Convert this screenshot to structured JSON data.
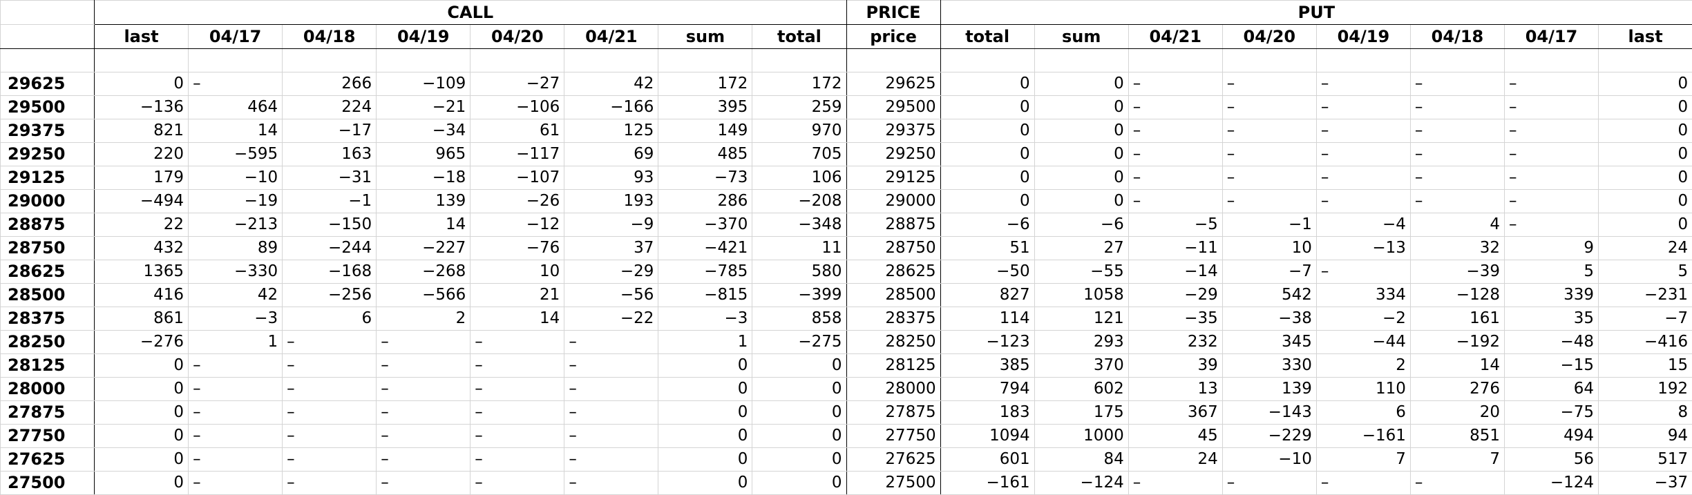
{
  "groups": {
    "call": "CALL",
    "price": "PRICE",
    "put": "PUT"
  },
  "headers": [
    "",
    "last",
    "04/17",
    "04/18",
    "04/19",
    "04/20",
    "04/21",
    "sum",
    "total",
    "price",
    "total",
    "sum",
    "04/21",
    "04/20",
    "04/19",
    "04/18",
    "04/17",
    "last"
  ],
  "rows": [
    [
      "29625",
      "0",
      "–",
      "266",
      "−109",
      "−27",
      "42",
      "172",
      "172",
      "29625",
      "0",
      "0",
      "–",
      "–",
      "–",
      "–",
      "–",
      "0"
    ],
    [
      "29500",
      "−136",
      "464",
      "224",
      "−21",
      "−106",
      "−166",
      "395",
      "259",
      "29500",
      "0",
      "0",
      "–",
      "–",
      "–",
      "–",
      "–",
      "0"
    ],
    [
      "29375",
      "821",
      "14",
      "−17",
      "−34",
      "61",
      "125",
      "149",
      "970",
      "29375",
      "0",
      "0",
      "–",
      "–",
      "–",
      "–",
      "–",
      "0"
    ],
    [
      "29250",
      "220",
      "−595",
      "163",
      "965",
      "−117",
      "69",
      "485",
      "705",
      "29250",
      "0",
      "0",
      "–",
      "–",
      "–",
      "–",
      "–",
      "0"
    ],
    [
      "29125",
      "179",
      "−10",
      "−31",
      "−18",
      "−107",
      "93",
      "−73",
      "106",
      "29125",
      "0",
      "0",
      "–",
      "–",
      "–",
      "–",
      "–",
      "0"
    ],
    [
      "29000",
      "−494",
      "−19",
      "−1",
      "139",
      "−26",
      "193",
      "286",
      "−208",
      "29000",
      "0",
      "0",
      "–",
      "–",
      "–",
      "–",
      "–",
      "0"
    ],
    [
      "28875",
      "22",
      "−213",
      "−150",
      "14",
      "−12",
      "−9",
      "−370",
      "−348",
      "28875",
      "−6",
      "−6",
      "−5",
      "−1",
      "−4",
      "4",
      "–",
      "0"
    ],
    [
      "28750",
      "432",
      "89",
      "−244",
      "−227",
      "−76",
      "37",
      "−421",
      "11",
      "28750",
      "51",
      "27",
      "−11",
      "10",
      "−13",
      "32",
      "9",
      "24"
    ],
    [
      "28625",
      "1365",
      "−330",
      "−168",
      "−268",
      "10",
      "−29",
      "−785",
      "580",
      "28625",
      "−50",
      "−55",
      "−14",
      "−7",
      "–",
      "−39",
      "5",
      "5"
    ],
    [
      "28500",
      "416",
      "42",
      "−256",
      "−566",
      "21",
      "−56",
      "−815",
      "−399",
      "28500",
      "827",
      "1058",
      "−29",
      "542",
      "334",
      "−128",
      "339",
      "−231"
    ],
    [
      "28375",
      "861",
      "−3",
      "6",
      "2",
      "14",
      "−22",
      "−3",
      "858",
      "28375",
      "114",
      "121",
      "−35",
      "−38",
      "−2",
      "161",
      "35",
      "−7"
    ],
    [
      "28250",
      "−276",
      "1",
      "–",
      "–",
      "–",
      "–",
      "1",
      "−275",
      "28250",
      "−123",
      "293",
      "232",
      "345",
      "−44",
      "−192",
      "−48",
      "−416"
    ],
    [
      "28125",
      "0",
      "–",
      "–",
      "–",
      "–",
      "–",
      "0",
      "0",
      "28125",
      "385",
      "370",
      "39",
      "330",
      "2",
      "14",
      "−15",
      "15"
    ],
    [
      "28000",
      "0",
      "–",
      "–",
      "–",
      "–",
      "–",
      "0",
      "0",
      "28000",
      "794",
      "602",
      "13",
      "139",
      "110",
      "276",
      "64",
      "192"
    ],
    [
      "27875",
      "0",
      "–",
      "–",
      "–",
      "–",
      "–",
      "0",
      "0",
      "27875",
      "183",
      "175",
      "367",
      "−143",
      "6",
      "20",
      "−75",
      "8"
    ],
    [
      "27750",
      "0",
      "–",
      "–",
      "–",
      "–",
      "–",
      "0",
      "0",
      "27750",
      "1094",
      "1000",
      "45",
      "−229",
      "−161",
      "851",
      "494",
      "94"
    ],
    [
      "27625",
      "0",
      "–",
      "–",
      "–",
      "–",
      "–",
      "0",
      "0",
      "27625",
      "601",
      "84",
      "24",
      "−10",
      "7",
      "7",
      "56",
      "517"
    ],
    [
      "27500",
      "0",
      "–",
      "–",
      "–",
      "–",
      "–",
      "0",
      "0",
      "27500",
      "−161",
      "−124",
      "–",
      "–",
      "–",
      "–",
      "−124",
      "−37"
    ]
  ]
}
